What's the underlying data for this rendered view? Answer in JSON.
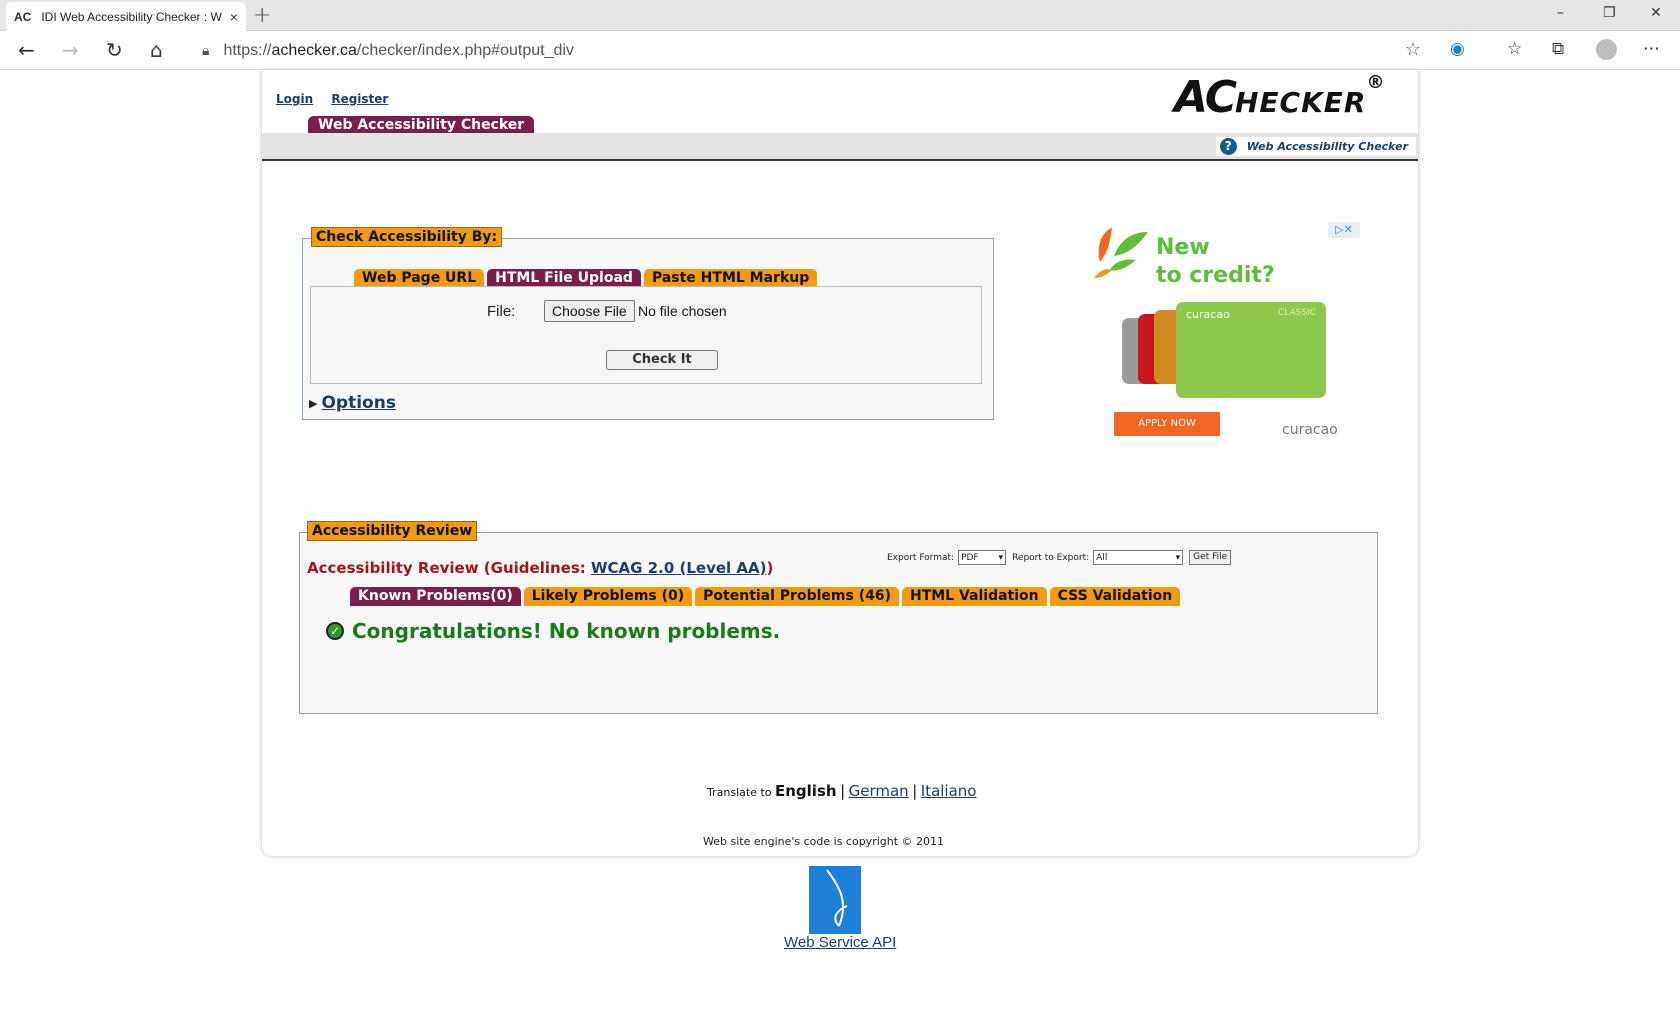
{
  "browser": {
    "tab_favicon": "AC",
    "tab_title": "IDI Web Accessibility Checker : W",
    "tab_close": "×",
    "new_tab": "+",
    "url_prefix": "https://",
    "url_host": "achecker.ca",
    "url_path": "/checker/index.php#output_div",
    "icons": [
      "back-icon",
      "forward-icon",
      "refresh-icon",
      "home-icon",
      "lock-icon",
      "favorite-star-icon",
      "edge-extension-icon",
      "favorites-icon",
      "collections-icon",
      "profile-icon",
      "more-icon"
    ]
  },
  "header": {
    "login": "Login",
    "register": "Register",
    "logo_ac": "AC",
    "logo_checker": "HECKER",
    "logo_reg": "®",
    "main_tab": "Web Accessibility Checker",
    "help_link": "Web Accessibility Checker"
  },
  "check": {
    "legend": "Check Accessibility By:",
    "tabs": [
      "Web Page URL",
      "HTML File Upload",
      "Paste HTML Markup"
    ],
    "active_tab": "HTML File Upload",
    "file_label": "File:",
    "choose_file": "Choose File",
    "no_file": "No file chosen",
    "check_button": "Check It",
    "options": "Options"
  },
  "ad": {
    "headline_1": "New",
    "headline_2": "to credit?",
    "card_brand": "curacao",
    "card_tier": "CLASSIC",
    "apply": "APPLY NOW",
    "brand": "curacao",
    "adchoices": "▷✕"
  },
  "review": {
    "legend": "Accessibility Review",
    "title_prefix": "Accessibility Review (Guidelines: ",
    "guideline": "WCAG 2.0 (Level AA)",
    "title_suffix": ")",
    "export_format_label": "Export Format:",
    "export_format_value": "PDF",
    "report_label": "Report to Export:",
    "report_value": "All",
    "get_file": "Get File",
    "tabs": [
      "Known Problems(0)",
      "Likely Problems (0)",
      "Potential Problems (46)",
      "HTML Validation",
      "CSS Validation"
    ],
    "active_tab": "Known Problems(0)",
    "message": "Congratulations! No known problems."
  },
  "footer": {
    "translate_label": "Translate to",
    "current_language": "English",
    "languages": [
      "German",
      "Italiano"
    ],
    "separator": "|",
    "copyright": "Web site engine's code is copyright © 2011",
    "api_link": "Web Service API"
  },
  "colors": {
    "accent_orange": "#f49a10",
    "accent_maroon": "#7a1f4d",
    "link_blue": "#1f3b6e",
    "success_green": "#1a7a1a",
    "title_red": "#a01515"
  }
}
